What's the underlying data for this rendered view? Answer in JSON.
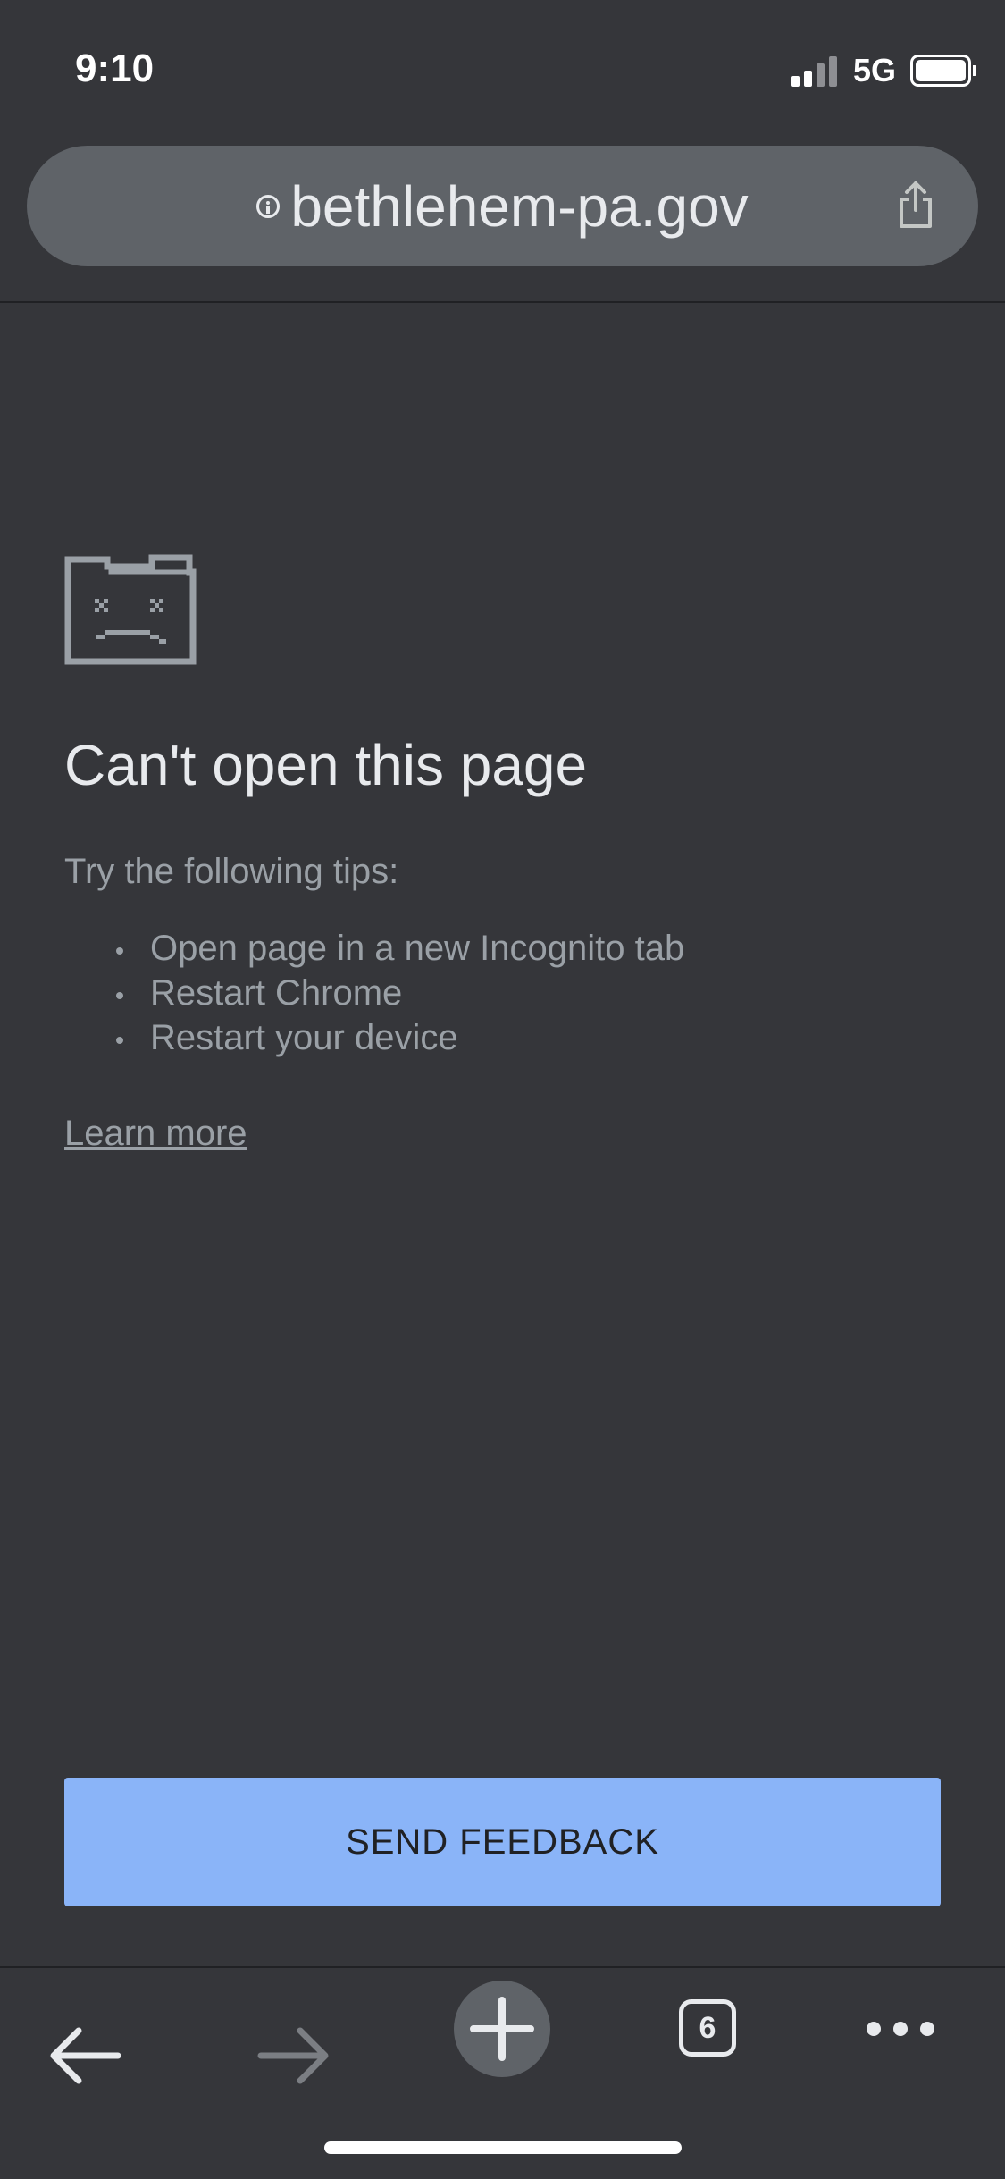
{
  "status_bar": {
    "time": "9:10",
    "network": "5G",
    "signal_bars_active": 2,
    "signal_bars_total": 4,
    "battery_level": 1.0
  },
  "omnibox": {
    "url": "bethlehem-pa.gov",
    "info_icon": "info-icon",
    "share_icon": "share-icon"
  },
  "error_page": {
    "icon": "sad-folder-icon",
    "title": "Can't open this page",
    "tips_label": "Try the following tips:",
    "tips": [
      "Open page in a new Incognito tab",
      "Restart Chrome",
      "Restart your device"
    ],
    "learn_more": "Learn more",
    "feedback_button": "SEND FEEDBACK"
  },
  "toolbar": {
    "back_icon": "back-arrow-icon",
    "forward_icon": "forward-arrow-icon",
    "new_tab_icon": "plus-icon",
    "tab_count": "6",
    "more_icon": "more-dots-icon"
  },
  "colors": {
    "background": "#35363a",
    "omnibox": "#5f6368",
    "accent_button": "#8ab4f8",
    "text_primary": "#e8eaed",
    "text_secondary": "#9aa0a6"
  }
}
